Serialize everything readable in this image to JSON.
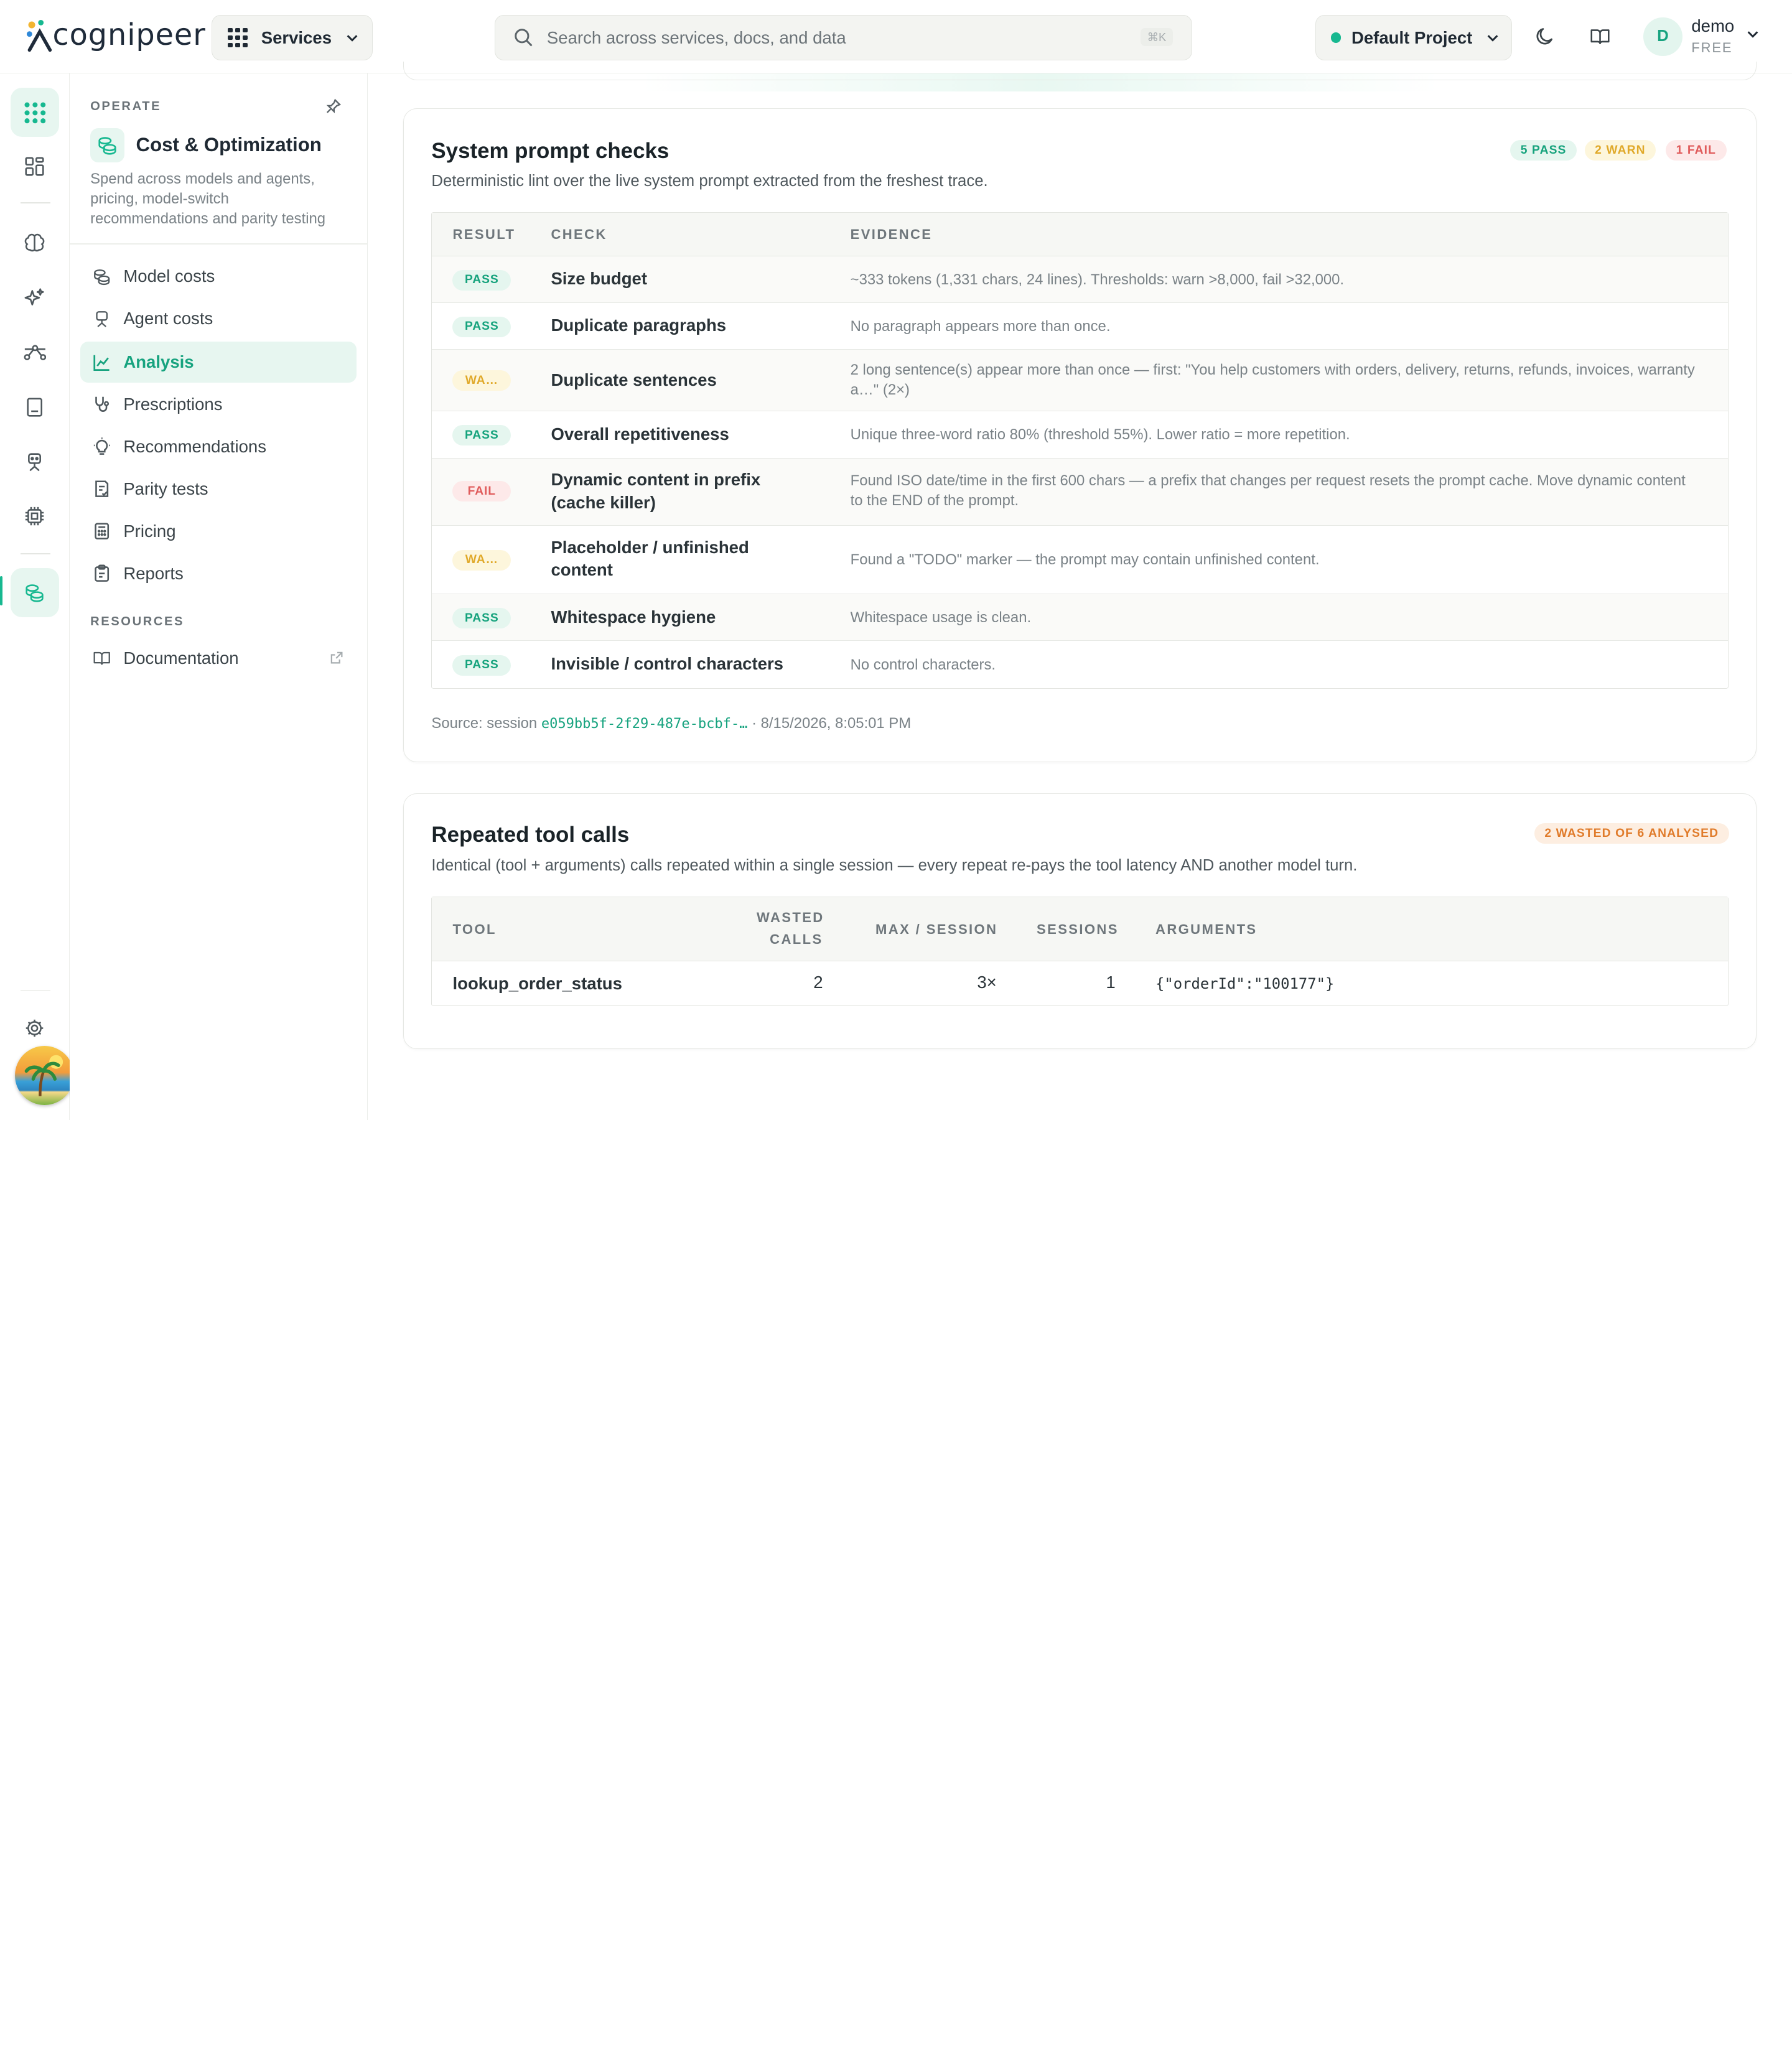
{
  "header": {
    "logo_text": "cognipeer",
    "services_label": "Services",
    "search_placeholder": "Search across services, docs, and data",
    "search_shortcut": "⌘K",
    "project_label": "Default Project",
    "user_initial": "D",
    "user_name": "demo",
    "user_plan": "FREE"
  },
  "rail": {
    "icons": [
      "apps-grid-icon",
      "dashboard-icon",
      "brain-icon",
      "sparkles-icon",
      "workflow-icon",
      "book-icon",
      "agent-icon",
      "chip-icon",
      "coins-icon"
    ],
    "active": "coins-icon"
  },
  "sidebar": {
    "section_label": "OPERATE",
    "title": "Cost & Optimization",
    "description": "Spend across models and agents, pricing, model-switch recommendations and parity testing",
    "items": [
      {
        "label": "Model costs",
        "icon": "coins-icon"
      },
      {
        "label": "Agent costs",
        "icon": "agent-icon"
      },
      {
        "label": "Analysis",
        "icon": "chart-icon",
        "active": true
      },
      {
        "label": "Prescriptions",
        "icon": "stethoscope-icon"
      },
      {
        "label": "Recommendations",
        "icon": "lightbulb-icon"
      },
      {
        "label": "Parity tests",
        "icon": "checklist-icon"
      },
      {
        "label": "Pricing",
        "icon": "calculator-icon"
      },
      {
        "label": "Reports",
        "icon": "clipboard-icon"
      }
    ],
    "resources_label": "RESOURCES",
    "resources": [
      {
        "label": "Documentation",
        "icon": "book-icon"
      }
    ]
  },
  "prompt_checks": {
    "title": "System prompt checks",
    "subtitle": "Deterministic lint over the live system prompt extracted from the freshest trace.",
    "summary": {
      "pass": "5 PASS",
      "warn": "2 WARN",
      "fail": "1 FAIL"
    },
    "columns": [
      "RESULT",
      "CHECK",
      "EVIDENCE"
    ],
    "rows": [
      {
        "result": "PASS",
        "status": "pass",
        "check": "Size budget",
        "evidence": "~333 tokens (1,331 chars, 24 lines). Thresholds: warn >8,000, fail >32,000."
      },
      {
        "result": "PASS",
        "status": "pass",
        "check": "Duplicate paragraphs",
        "evidence": "No paragraph appears more than once."
      },
      {
        "result": "WA…",
        "status": "warn",
        "check": "Duplicate sentences",
        "evidence": "2 long sentence(s) appear more than once — first: \"You help customers with orders, delivery, returns, refunds, invoices, warranty a…\" (2×)"
      },
      {
        "result": "PASS",
        "status": "pass",
        "check": "Overall repetitiveness",
        "evidence": "Unique three-word ratio 80% (threshold 55%). Lower ratio = more repetition."
      },
      {
        "result": "FAIL",
        "status": "fail",
        "check": "Dynamic content in prefix (cache killer)",
        "evidence": "Found ISO date/time in the first 600 chars — a prefix that changes per request resets the prompt cache. Move dynamic content to the END of the prompt."
      },
      {
        "result": "WA…",
        "status": "warn",
        "check": "Placeholder / unfinished content",
        "evidence": "Found a \"TODO\" marker — the prompt may contain unfinished content."
      },
      {
        "result": "PASS",
        "status": "pass",
        "check": "Whitespace hygiene",
        "evidence": "Whitespace usage is clean."
      },
      {
        "result": "PASS",
        "status": "pass",
        "check": "Invisible / control characters",
        "evidence": "No control characters."
      }
    ],
    "source_prefix": "Source: session",
    "source_session": "e059bb5f-2f29-487e-bcbf-…",
    "source_time": "· 8/15/2026, 8:05:01 PM"
  },
  "tool_calls": {
    "title": "Repeated tool calls",
    "subtitle": "Identical (tool + arguments) calls repeated within a single session — every repeat re-pays the tool latency AND another model turn.",
    "badge": "2 WASTED OF 6 ANALYSED",
    "columns": {
      "tool": "TOOL",
      "wasted_1": "WASTED",
      "wasted_2": "CALLS",
      "max": "MAX / SESSION",
      "sessions": "SESSIONS",
      "args": "ARGUMENTS"
    },
    "rows": [
      {
        "tool": "lookup_order_status",
        "wasted": "2",
        "max": "3×",
        "sessions": "1",
        "args": "{\"orderId\":\"100177\"}"
      }
    ]
  },
  "colors": {
    "accent": "#17a37f",
    "pass": "#16a37d",
    "warn": "#e0a92a",
    "fail": "#e05b5b",
    "orange": "#e07b2a"
  }
}
